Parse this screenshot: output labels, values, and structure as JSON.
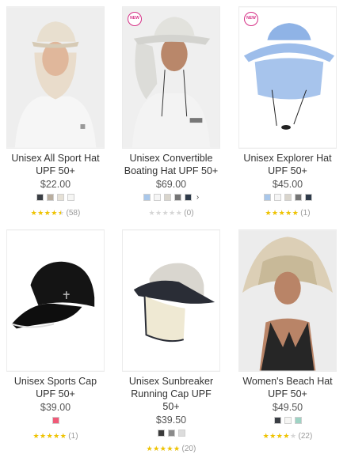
{
  "products": [
    {
      "name_lines": [
        "Unisex All Sport Hat",
        "UPF 50+"
      ],
      "price": "$22.00",
      "is_new": false,
      "new_badge": "",
      "swatches": [
        "#3a3e44",
        "#b9ae9f",
        "#e6e1d6",
        "#f6f6f4"
      ],
      "has_more": false,
      "more_icon": "",
      "rating": 4.5,
      "rating_count": "(58)",
      "image_icon": "all-sport-hat-photo"
    },
    {
      "name_lines": [
        "Unisex Convertible",
        "Boating Hat UPF 50+"
      ],
      "price": "$69.00",
      "is_new": true,
      "new_badge": "NEW",
      "swatches": [
        "#a9c7ea",
        "#f5f5f5",
        "#d9d5cc",
        "#757575",
        "#2f3b4a"
      ],
      "has_more": true,
      "more_icon": "›",
      "rating": 0,
      "rating_count": "(0)",
      "image_icon": "convertible-boating-hat-photo"
    },
    {
      "name_lines": [
        "Unisex Explorer Hat",
        "UPF 50+"
      ],
      "price": "$45.00",
      "is_new": true,
      "new_badge": "NEW",
      "swatches": [
        "#a9c7ea",
        "#f5f5f5",
        "#d9d5cc",
        "#757575",
        "#2f3b4a"
      ],
      "has_more": false,
      "more_icon": "",
      "rating": 5,
      "rating_count": "(1)",
      "image_icon": "explorer-hat-photo"
    },
    {
      "name_lines": [
        "Unisex Sports Cap",
        "UPF 50+"
      ],
      "price": "$39.00",
      "is_new": false,
      "new_badge": "",
      "swatches": [
        "#f05a78"
      ],
      "has_more": false,
      "more_icon": "",
      "rating": 5,
      "rating_count": "(1)",
      "image_icon": "sports-cap-photo"
    },
    {
      "name_lines": [
        "Unisex Sunbreaker",
        "Running Cap UPF",
        "50+"
      ],
      "price": "$39.50",
      "is_new": false,
      "new_badge": "",
      "swatches": [
        "#3a3a3a",
        "#8a8a8a",
        "#dcdcdc"
      ],
      "has_more": false,
      "more_icon": "",
      "rating": 5,
      "rating_count": "(20)",
      "image_icon": "sunbreaker-running-cap-photo"
    },
    {
      "name_lines": [
        "Women's Beach Hat",
        "UPF 50+"
      ],
      "price": "$49.50",
      "is_new": false,
      "new_badge": "",
      "swatches": [
        "#3a3e44",
        "#f6f6f4",
        "#9ed3c4"
      ],
      "has_more": false,
      "more_icon": "",
      "rating": 4,
      "rating_count": "(22)",
      "image_icon": "beach-hat-photo"
    }
  ],
  "colors": {
    "star": "#f0c400",
    "star_empty": "#d6d6d6",
    "badge": "#d62f86"
  }
}
